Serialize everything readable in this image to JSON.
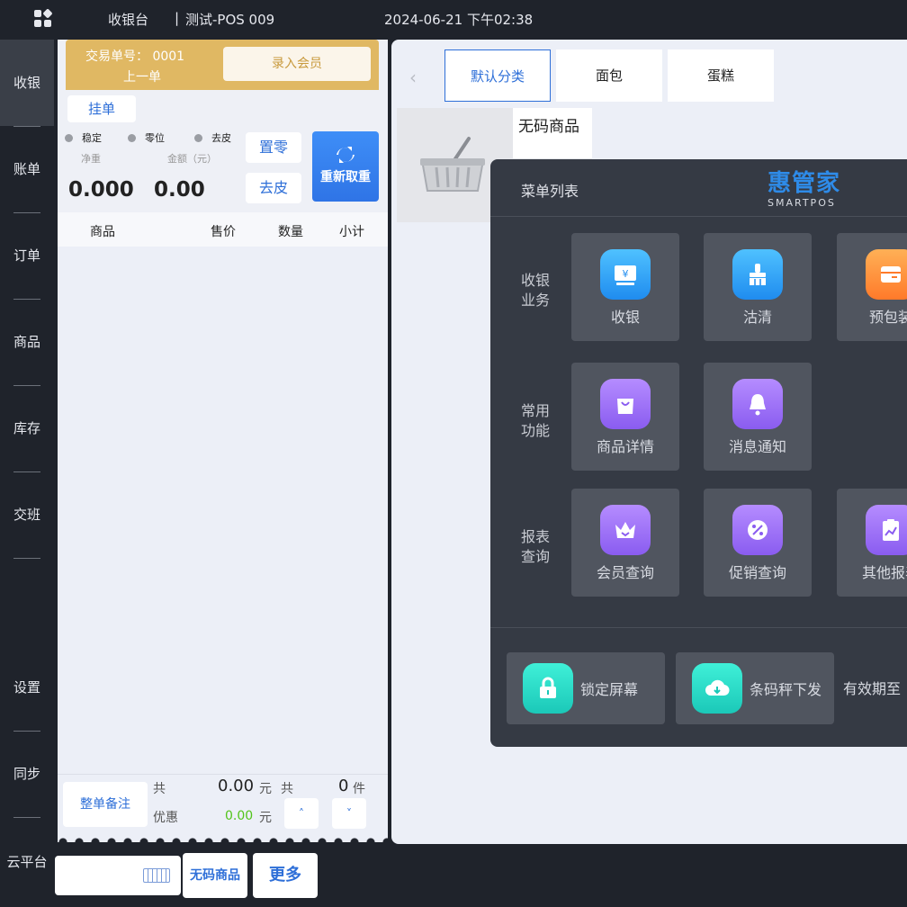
{
  "header": {
    "app_title": "收银台",
    "separator": "|",
    "device": "测试-POS 009",
    "datetime": "2024-06-21 下午02:38"
  },
  "nav": {
    "items": [
      {
        "label": "收银"
      },
      {
        "label": "账单"
      },
      {
        "label": "订单"
      },
      {
        "label": "商品"
      },
      {
        "label": "库存"
      },
      {
        "label": "交班"
      },
      {
        "label": "设置"
      },
      {
        "label": "同步"
      },
      {
        "label": "云平台"
      }
    ]
  },
  "cart": {
    "ticket_no_label": "交易单号：  0001",
    "prev_order": "上一单",
    "member_button": "录入会员",
    "pending_button": "挂单",
    "status_stable": "稳定",
    "status_zero": "零位",
    "status_tare": "去皮",
    "net_weight_label": "净重",
    "amount_label": "金额（元）",
    "net_weight": "0.000",
    "amount": "0.00",
    "zero_button": "置零",
    "tare_button": "去皮",
    "reweigh_button": "重新取重",
    "columns": [
      "商品",
      "售价",
      "数量",
      "小计"
    ]
  },
  "footer": {
    "note_button": "整单备注",
    "total_label": "共",
    "total_amount": "0.00",
    "yuan": "元",
    "count_label": "共",
    "count": "0",
    "count_unit": "件",
    "discount_label": "优惠",
    "discount_amount": "0.00",
    "up_arrow": "˄",
    "down_arrow": "˅"
  },
  "bottom": {
    "barcode_placeholder": "",
    "no_code_button": "无码商品",
    "more_button": "更多"
  },
  "goods": {
    "back": "‹",
    "categories": [
      {
        "label": "默认分类",
        "active": true
      },
      {
        "label": "面包",
        "active": false
      },
      {
        "label": "蛋糕",
        "active": false
      }
    ],
    "items": [
      {
        "name": "无码商品"
      }
    ]
  },
  "menu": {
    "title": "菜单列表",
    "brand_main": "惠管家",
    "brand_sub": "SMARTPOS",
    "sections": [
      {
        "label": "收银业务",
        "tiles": [
          {
            "label": "收银",
            "icon": "cashier-icon",
            "color": "#1f8cef"
          },
          {
            "label": "沽清",
            "icon": "broom-icon",
            "color": "#1f8cef"
          },
          {
            "label": "预包装",
            "icon": "package-icon",
            "color": "#ff7a2a"
          }
        ]
      },
      {
        "label": "常用功能",
        "tiles": [
          {
            "label": "商品详情",
            "icon": "shopping-bag-icon",
            "color": "#8a5cf0"
          },
          {
            "label": "消息通知",
            "icon": "bell-icon",
            "color": "#8a5cf0"
          }
        ]
      },
      {
        "label": "报表查询",
        "tiles": [
          {
            "label": "会员查询",
            "icon": "crown-icon",
            "color": "#8a5cf0"
          },
          {
            "label": "促销查询",
            "icon": "discount-icon",
            "color": "#8a5cf0"
          },
          {
            "label": "其他报表",
            "icon": "clipboard-chart-icon",
            "color": "#8a5cf0"
          }
        ]
      }
    ],
    "lock_screen": "锁定屏幕",
    "scale_download": "条码秤下发",
    "validity": "有效期至"
  }
}
